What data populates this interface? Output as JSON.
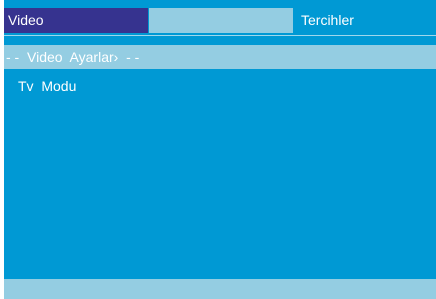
{
  "tabs": {
    "video": "Video",
    "blank": "",
    "preferences": "Tercihler"
  },
  "section": {
    "header": "- -  Video  Ayarlar›  - -"
  },
  "menu": {
    "items": [
      {
        "label": "Tv  Modu"
      }
    ]
  },
  "status": {
    "text": ""
  },
  "colors": {
    "background": "#0099d4",
    "active_tab": "#36338f",
    "light_bar": "#94cde2",
    "text": "#ffffff"
  }
}
